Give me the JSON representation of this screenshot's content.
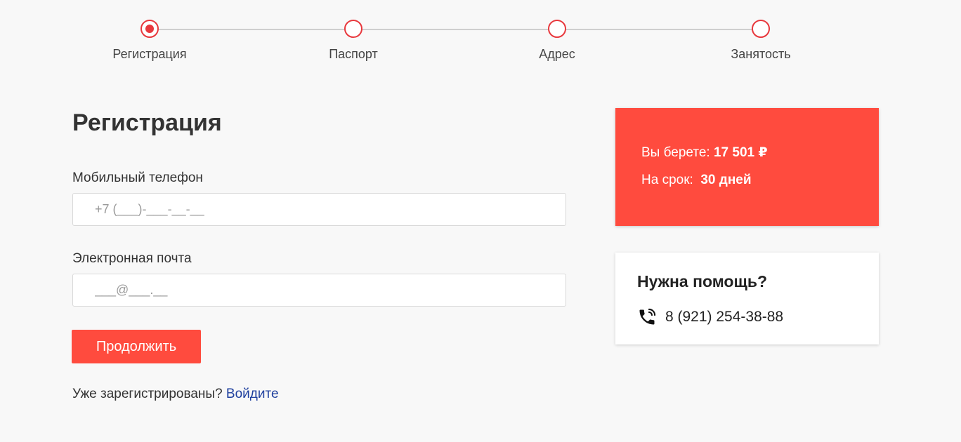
{
  "steps": [
    {
      "label": "Регистрация",
      "active": true
    },
    {
      "label": "Паспорт",
      "active": false
    },
    {
      "label": "Адрес",
      "active": false
    },
    {
      "label": "Занятость",
      "active": false
    }
  ],
  "page_title": "Регистрация",
  "form": {
    "phone_label": "Мобильный телефон",
    "phone_placeholder": "+7 (___)-___-__-__",
    "email_label": "Электронная почта",
    "email_placeholder": "___@___.__",
    "submit_label": "Продолжить",
    "login_prompt": "Уже зарегистрированы?",
    "login_link": "Войдите"
  },
  "summary": {
    "amount_label": "Вы берете:",
    "amount_value": "17 501 ₽",
    "term_label": "На срок:",
    "term_value": "30 дней"
  },
  "help": {
    "title": "Нужна помощь?",
    "phone": "8 (921) 254-38-88",
    "icon": "phone-icon"
  },
  "colors": {
    "accent": "#ff4b3e",
    "step": "#e8383d",
    "link": "#1e3f9e"
  }
}
